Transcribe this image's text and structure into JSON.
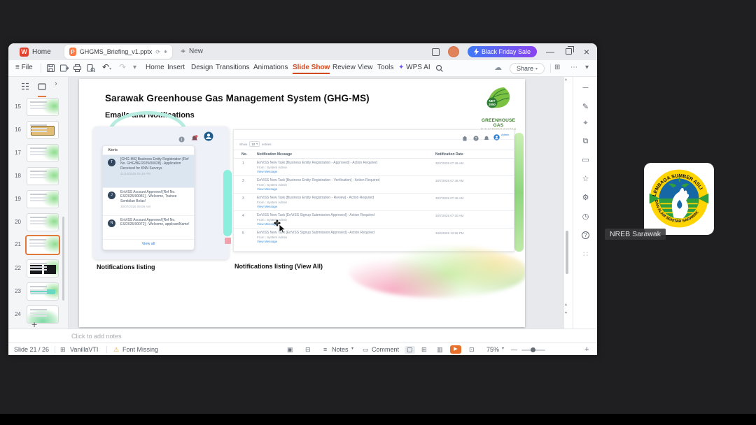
{
  "colors": {
    "accent_orange": "#d1491f",
    "promo_gradient_start": "#3f79f6",
    "promo_gradient_end": "#8a43f0",
    "link_blue": "#2f7fd1",
    "alert_highlight": "#dce6f0",
    "selected_thumb_border": "#e0793a",
    "play_button_orange": "#e8702a",
    "font_missing_warning": "#e6a23c",
    "teal_accent": "#8ceedd"
  },
  "titlebar": {
    "home_tab_label": "Home",
    "document_tab_label": "GHGMS_Briefing_v1.pptx",
    "new_tab_label": "New",
    "promo_label": "Black Friday Sale"
  },
  "menubar": {
    "file_label": "File",
    "items": [
      "Home",
      "Insert",
      "Design",
      "Transitions",
      "Animations",
      "Slide Show",
      "Review",
      "View",
      "Tools",
      "WPS AI"
    ],
    "share_label": "Share"
  },
  "thumbnail_panel": {
    "slides": [
      {
        "num": "15"
      },
      {
        "num": "16"
      },
      {
        "num": "17"
      },
      {
        "num": "18"
      },
      {
        "num": "19"
      },
      {
        "num": "20"
      },
      {
        "num": "21"
      },
      {
        "num": "22"
      },
      {
        "num": "23"
      },
      {
        "num": "24"
      }
    ]
  },
  "slide": {
    "title": "Sarawak Greenhouse Gas Management System (GHG-MS)",
    "subtitle": "Emails and Notifications",
    "logo": {
      "badge_line1": "NET",
      "badge_line2": "2050",
      "name_line1": "GREENHOUSE GAS",
      "name_line2": "MANAGEMENT SYSTEM"
    },
    "caption_left": "Notifications listing",
    "caption_right": "Notifications listing (View All)",
    "alerts_panel": {
      "title": "Alerts",
      "view_all_label": "View all",
      "items": [
        {
          "avatar": "T",
          "text": "[GHG-MS] Business Entity Registration [Ref No. GHG/BE/2025/00028] - Application Received for KNN Surveys",
          "time": "21/10/2025 02:19 PM"
        },
        {
          "avatar": "J",
          "text": "EnViSS Account Approved [Ref No. ES/2025/00081] - Welcome, Trainee Sembilan Belas!",
          "time": "30/07/2025 09:09 AM"
        },
        {
          "avatar": "N",
          "text": "EnViSS Account Approved [Ref No. ES/2025/00072] - Welcome, applicantName!",
          "time": ""
        }
      ]
    },
    "notifications_table": {
      "user_label": "Admin",
      "show_label": "Show",
      "page_size": "10",
      "entries_label": "entries",
      "col_no": "No.",
      "col_message": "Notification Message",
      "col_date": "Notification Date",
      "from_label": "From : System Admin",
      "view_message_label": "View Message",
      "rows": [
        {
          "no": "1",
          "message": "EnViSS New Task [Business Entity Registration - Approved] - Action Required",
          "date": "30/7/2025 07:49 AM"
        },
        {
          "no": "2",
          "message": "EnViSS New Task [Business Entity Registration - Verification] - Action Required",
          "date": "30/7/2025 07:48 AM"
        },
        {
          "no": "3",
          "message": "EnViSS New Task [Business Entity Registration - Review] - Action Required",
          "date": "30/7/2025 07:46 AM"
        },
        {
          "no": "4",
          "message": "EnViSS New Task [EnViSS Signup Submission Approved] - Action Required",
          "date": "30/7/2025 07:30 AM"
        },
        {
          "no": "5",
          "message": "EnViSS New Task [EnViSS Signup Submission Approved] - Action Required",
          "date": "16/6/2025 12:56 PM"
        }
      ]
    }
  },
  "notes_bar": {
    "placeholder": "Click to add notes"
  },
  "statusbar": {
    "slide_counter": "Slide 21 / 26",
    "theme_name": "VanillaVTI",
    "font_missing_label": "Font Missing",
    "notes_label": "Notes",
    "comment_label": "Comment",
    "zoom_level": "75%"
  },
  "participant": {
    "name": "NREB Sarawak",
    "seal_top_text": "LEMBAGA SUMBER ASLI",
    "seal_bottom_text": "DAN ALAM SEKITAR SARAWAK"
  }
}
